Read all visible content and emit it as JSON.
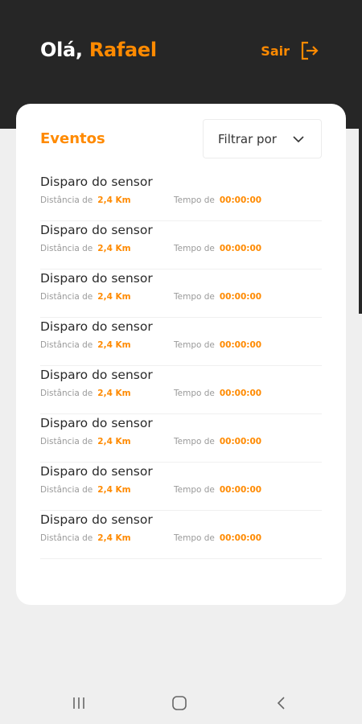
{
  "header": {
    "greeting_prefix": "Olá,",
    "user_name": "Rafael",
    "logout_label": "Sair",
    "logout_icon": "logout-icon"
  },
  "events_card": {
    "title": "Eventos",
    "filter_label": "Filtrar por",
    "items": [
      {
        "title": "Disparo do sensor",
        "distance_label": "Distância de",
        "distance_value": "2,4 Km",
        "time_label": "Tempo de",
        "time_value": "00:00:00"
      },
      {
        "title": "Disparo do sensor",
        "distance_label": "Distância de",
        "distance_value": "2,4 Km",
        "time_label": "Tempo de",
        "time_value": "00:00:00"
      },
      {
        "title": "Disparo do sensor",
        "distance_label": "Distância de",
        "distance_value": "2,4 Km",
        "time_label": "Tempo de",
        "time_value": "00:00:00"
      },
      {
        "title": "Disparo do sensor",
        "distance_label": "Distância de",
        "distance_value": "2,4 Km",
        "time_label": "Tempo de",
        "time_value": "00:00:00"
      },
      {
        "title": "Disparo do sensor",
        "distance_label": "Distância de",
        "distance_value": "2,4 Km",
        "time_label": "Tempo de",
        "time_value": "00:00:00"
      },
      {
        "title": "Disparo do sensor",
        "distance_label": "Distância de",
        "distance_value": "2,4 Km",
        "time_label": "Tempo de",
        "time_value": "00:00:00"
      },
      {
        "title": "Disparo do sensor",
        "distance_label": "Distância de",
        "distance_value": "2,4 Km",
        "time_label": "Tempo de",
        "time_value": "00:00:00"
      },
      {
        "title": "Disparo do sensor",
        "distance_label": "Distância de",
        "distance_value": "2,4 Km",
        "time_label": "Tempo de",
        "time_value": "00:00:00"
      }
    ]
  },
  "colors": {
    "accent": "#ff8a00",
    "header_bg": "#262626",
    "page_bg": "#efefef",
    "card_bg": "#ffffff"
  },
  "navbar": {
    "icons": [
      "recent-apps-icon",
      "home-icon",
      "back-icon"
    ]
  }
}
